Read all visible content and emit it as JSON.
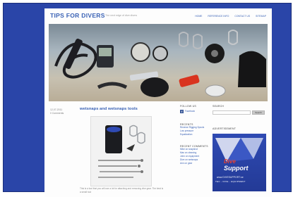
{
  "site": {
    "title": "TIPS FOR DIVERS",
    "tagline": "The next edge of dive divers"
  },
  "nav": [
    "HOME",
    "REFERENCE INFO",
    "CONTACT US",
    "SITEMAP"
  ],
  "post": {
    "date_lines": [
      "12-07-2011",
      "0 Comments"
    ],
    "title": "wetsnaps and wetsnaps tools",
    "text": "This is a tool that you will use a lot for attaching and removing dive gear. The best is a small tool"
  },
  "sidebar_left": {
    "follow_title": "FOLLOW US",
    "follow_link": "Facebook",
    "recent_title": "RECENTS",
    "recent_links": [
      "Reverse Rigging Spools",
      "Low pressure",
      "Equalization"
    ],
    "comments_title": "RECENT COMMENTS",
    "comments": [
      "Mike on snapshot",
      "Max on cleaning",
      "John on equipment",
      "Dive on wetsnaps",
      "Ann on gear"
    ]
  },
  "sidebar_right": {
    "search_title": "SEARCH",
    "search_button": "Search",
    "ad_title": "ADVERTISEMENT",
    "ad_word1": "Dive",
    "ad_word2": "Support",
    "ad_url": "www.DIVESUPPORT.se",
    "ad_tagline": "TEC - DIVE - EQUIPMENT"
  },
  "colors": {
    "frame": "#2a45a8",
    "link": "#3a62b5",
    "ad_bg": "#2f4ab3",
    "ad_red": "#e84030"
  }
}
